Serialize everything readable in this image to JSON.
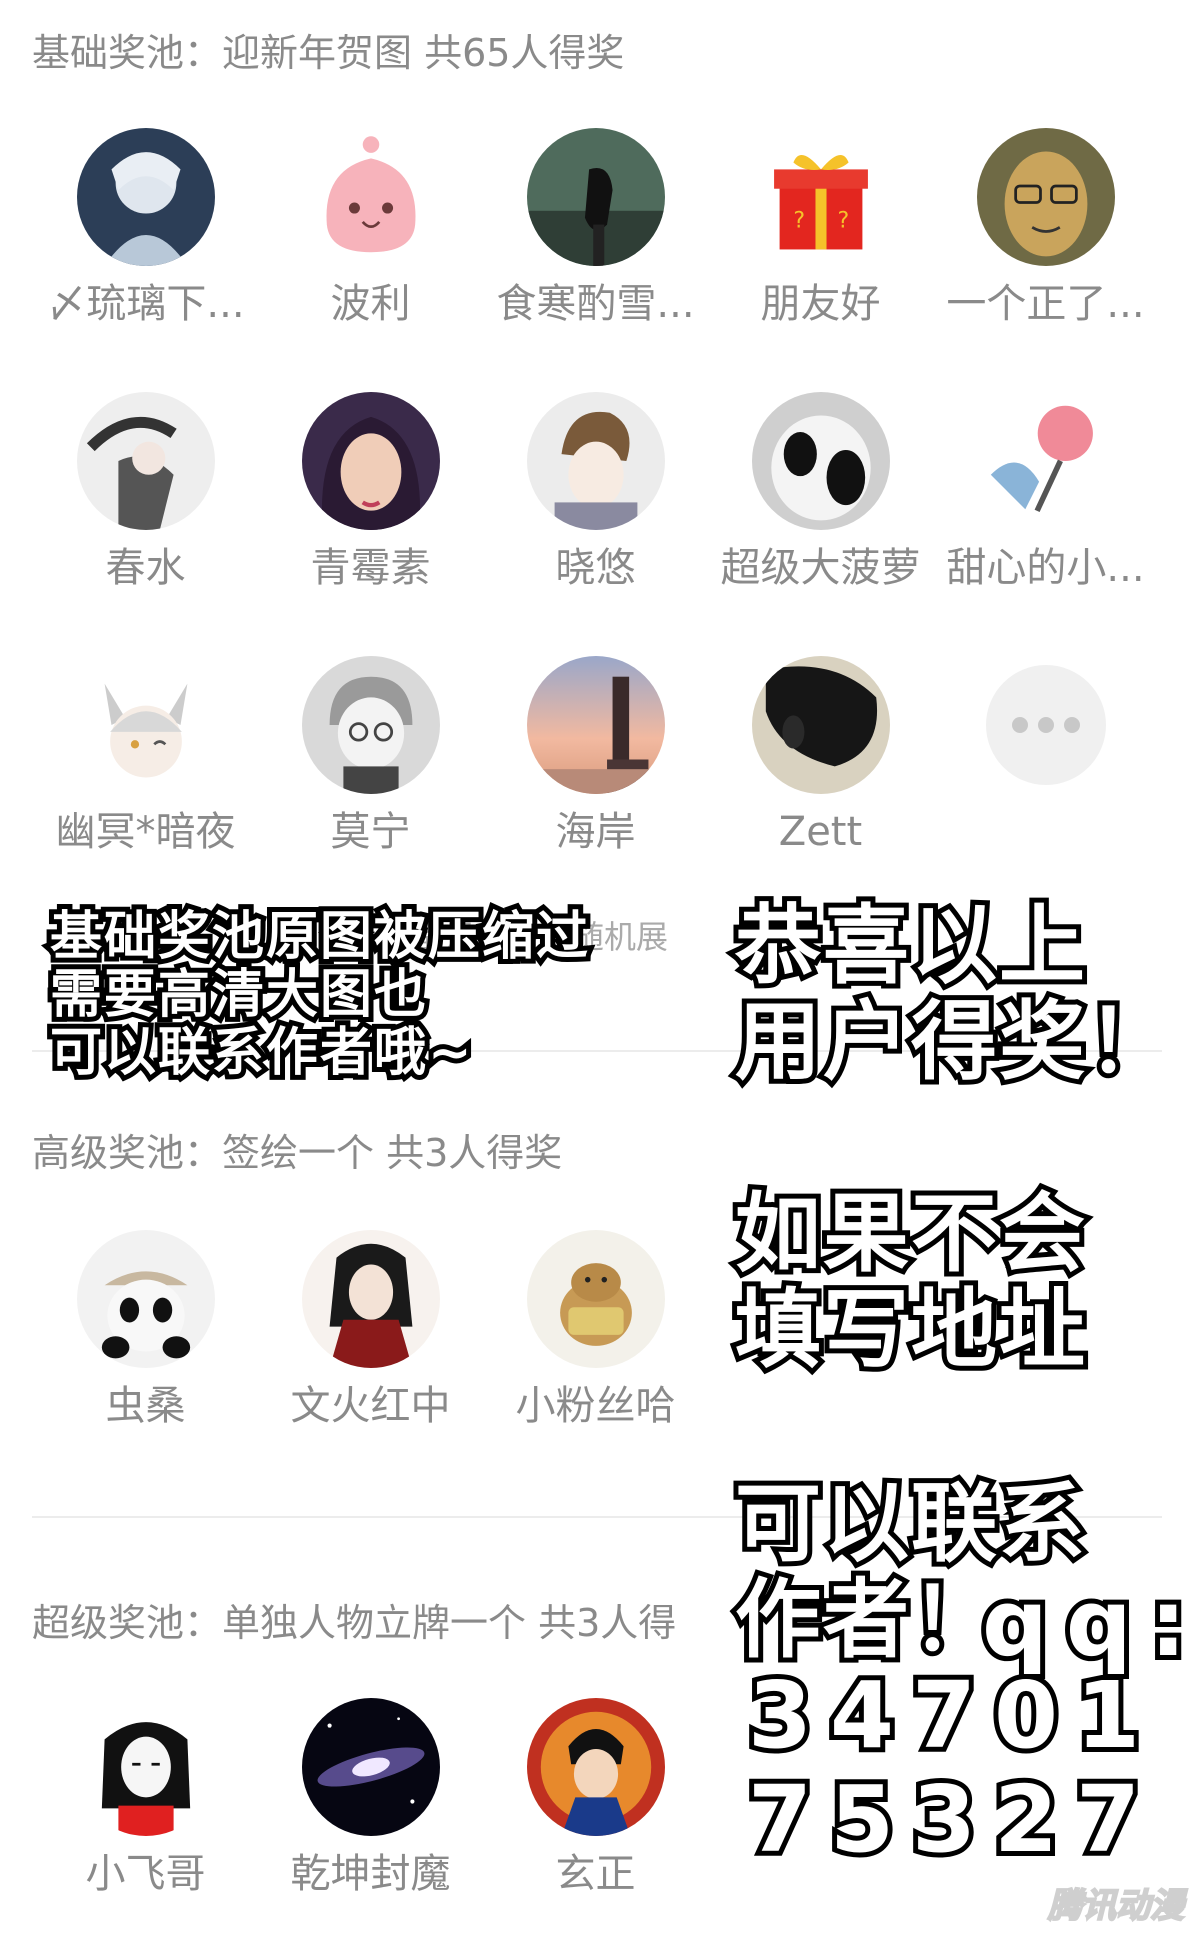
{
  "basic_pool": {
    "title": "基础奖池：迎新年贺图 共65人得奖",
    "note": "的都是欧皇，随机展",
    "users": [
      {
        "name": "〆琉璃下..."
      },
      {
        "name": "波利"
      },
      {
        "name": "食寒酌雪..."
      },
      {
        "name": "朋友好"
      },
      {
        "name": "一个正了..."
      },
      {
        "name": "春水"
      },
      {
        "name": "青霉素"
      },
      {
        "name": "晓悠"
      },
      {
        "name": "超级大菠萝"
      },
      {
        "name": "甜心的小..."
      },
      {
        "name": "幽冥*暗夜"
      },
      {
        "name": "莫宁"
      },
      {
        "name": "海岸"
      },
      {
        "name": "Zett"
      }
    ],
    "more_icon": "more-dots-icon"
  },
  "advanced_pool": {
    "title": "高级奖池：签绘一个 共3人得奖",
    "users": [
      {
        "name": "虫桑"
      },
      {
        "name": "文火红中"
      },
      {
        "name": "小粉丝哈"
      }
    ]
  },
  "super_pool": {
    "title": "超级奖池：单独人物立牌一个 共3人得",
    "users": [
      {
        "name": "小飞哥"
      },
      {
        "name": "乾坤封魔"
      },
      {
        "name": "玄正"
      }
    ]
  },
  "overlay": {
    "left_line1": "基础奖池原图被压缩过",
    "left_line2": "需要高清大图也",
    "left_line3": "可以联系作者哦~",
    "right_line1": "恭喜以上",
    "right_line2": "用户得奖！",
    "right_line3": "如果不会",
    "right_line4": "填写地址",
    "right_line5": "可以联系",
    "right_line6": "作者！",
    "qq_label": "qq:",
    "qq_number_1": "34701",
    "qq_number_2": "75327"
  },
  "watermark": "腾讯动漫",
  "colors": {
    "background": "#ffffff",
    "text_gray": "#8a8a8a",
    "overlay_fill": "#ffffff",
    "overlay_stroke": "#000000"
  }
}
